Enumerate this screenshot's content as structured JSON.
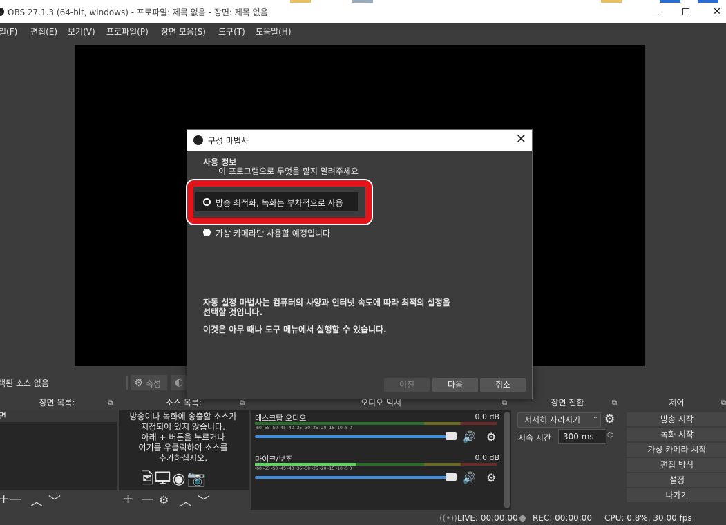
{
  "window": {
    "title": "OBS 27.1.3 (64-bit, windows) - 프로파일: 제목 없음 - 장면: 제목 없음",
    "minimize_icon": "minimize-icon",
    "maximize_icon": "maximize-icon",
    "close_glyph": "✕"
  },
  "menu": [
    "일(F)",
    "편집(E)",
    "보기(V)",
    "프로파일(P)",
    "장면 모음(S)",
    "도구(T)",
    "도움말(H)"
  ],
  "source_toolbar": {
    "no_source": "택된 소스 없음",
    "properties_label": "속성",
    "properties_icon": "gear-icon",
    "filters_icon": "filter-icon"
  },
  "docks": {
    "scenes": {
      "title": "장면 목록:",
      "item": "면"
    },
    "sources": {
      "title": "소스 목록:",
      "message": [
        "방송이나 녹화에 송출할 소스가",
        "지정되어 있지 않습니다.",
        "아래 + 버튼을 누르거나",
        "여기를 우클릭하여 소스를",
        "추가하십시오."
      ]
    },
    "mixer": {
      "title": "오디오 믹서",
      "channels": [
        {
          "name": "데스크탑 오디오",
          "db": "0.0 dB",
          "level": 0
        },
        {
          "name": "마이크/보조",
          "db": "0.0 dB",
          "level": 0.42
        }
      ],
      "ticks": "-60  -55  -50  -45  -40  -35  -30  -25  -20  -15  -10  -5  0"
    },
    "transitions": {
      "title": "장면 전환",
      "selected": "서서히 사라지기",
      "duration_label": "지속 시간",
      "duration_value": "300 ms"
    },
    "controls": {
      "title": "제어",
      "buttons": [
        "방송 시작",
        "녹화 시작",
        "가상 카메라 시작",
        "편집 방식",
        "설정",
        "나가기"
      ]
    }
  },
  "status": {
    "live": "LIVE: 00:00:00",
    "rec": "REC: 00:00:00",
    "cpu": "CPU: 0.8%, 30.00 fps"
  },
  "wizard": {
    "title": "구성 마법사",
    "heading": "사용 정보",
    "subheading": "이 프로그램으로 무엇을 할지 알려주세요",
    "option_stream": "방송 최적화, 녹화는 부차적으로 사용",
    "option_vcam": "가상 카메라만 사용할 예정입니다",
    "desc_line1": "자동 설정 마법사는 컴퓨터의 사양과 인터넷 속도에 따라 최적의 설정을",
    "desc_line2": "선택할 것입니다.",
    "desc_line3": "이것은 아무 때나 도구 메뉴에서 실행할 수 있습니다.",
    "btn_prev": "이전",
    "btn_next": "다음",
    "btn_cancel": "취소",
    "highlight_color": "#e3151a"
  }
}
